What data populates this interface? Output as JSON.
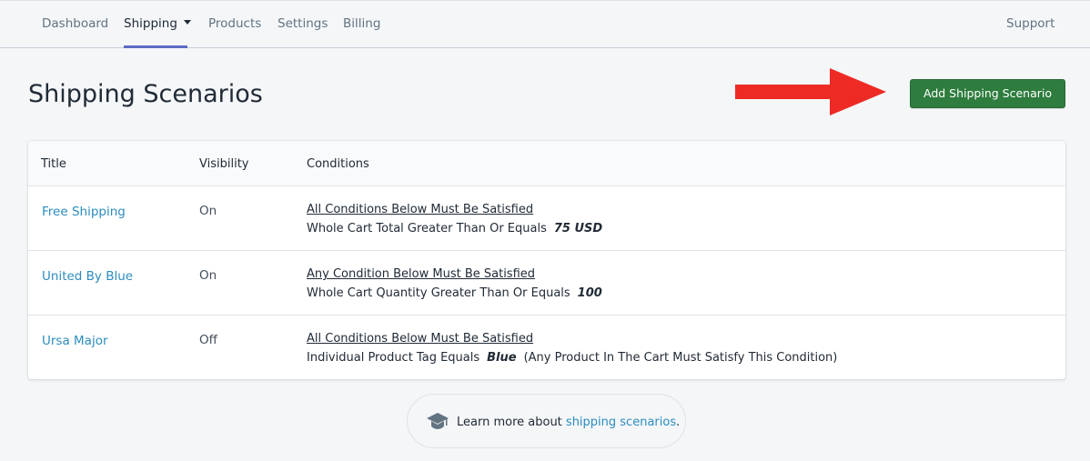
{
  "nav": {
    "items": [
      {
        "label": "Dashboard"
      },
      {
        "label": "Shipping"
      },
      {
        "label": "Products"
      },
      {
        "label": "Settings"
      },
      {
        "label": "Billing"
      }
    ],
    "support": "Support",
    "active": "Shipping"
  },
  "page": {
    "title": "Shipping Scenarios",
    "add_button": "Add Shipping Scenario"
  },
  "table": {
    "headers": {
      "title": "Title",
      "visibility": "Visibility",
      "conditions": "Conditions"
    },
    "rows": [
      {
        "title": "Free Shipping",
        "visibility": "On",
        "condition_rule": "All Conditions Below Must Be Satisfied",
        "condition_text": "Whole Cart Total Greater Than Or Equals",
        "condition_value": "75 USD",
        "condition_note": ""
      },
      {
        "title": "United By Blue",
        "visibility": "On",
        "condition_rule": "Any Condition Below Must Be Satisfied",
        "condition_text": "Whole Cart Quantity Greater Than Or Equals",
        "condition_value": "100",
        "condition_note": ""
      },
      {
        "title": "Ursa Major",
        "visibility": "Off",
        "condition_rule": "All Conditions Below Must Be Satisfied",
        "condition_text": "Individual Product Tag Equals",
        "condition_value": "Blue",
        "condition_note": "(Any Product In The Cart Must Satisfy This Condition)"
      }
    ]
  },
  "help": {
    "prefix": "Learn more about ",
    "link": "shipping scenarios",
    "suffix": "."
  },
  "colors": {
    "accent_nav": "#5c6ac4",
    "primary_button": "#2e7d3e",
    "link": "#2b8cbf",
    "arrow": "#ee2a24"
  },
  "icons": {
    "nav_dropdown": "caret-down-icon",
    "help": "graduation-cap-icon",
    "callout": "red-arrow-right"
  }
}
